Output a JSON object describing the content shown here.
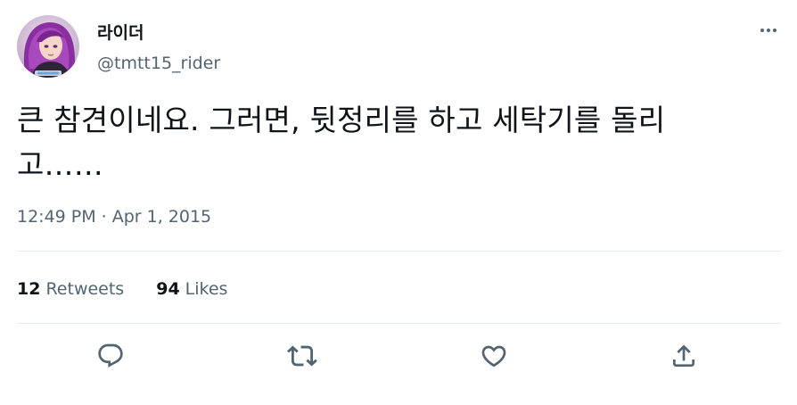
{
  "user": {
    "display_name": "라이더",
    "handle": "@tmtt15_rider",
    "avatar_icon": "profile-avatar"
  },
  "tweet": {
    "text_line1": "큰 참견이네요. 그러면, 뒷정리를 하고 세탁기를 돌리",
    "text_line2": "고……",
    "time": "12:49 PM",
    "separator": "·",
    "date": "Apr 1, 2015"
  },
  "stats": {
    "retweets_count": "12",
    "retweets_label": "Retweets",
    "likes_count": "94",
    "likes_label": "Likes"
  },
  "actions": {
    "reply_icon": "reply-icon",
    "retweet_icon": "retweet-icon",
    "like_icon": "heart-icon",
    "share_icon": "share-icon"
  },
  "colors": {
    "text": "#0f1419",
    "secondary": "#536471",
    "divider": "#e6ecf0"
  }
}
